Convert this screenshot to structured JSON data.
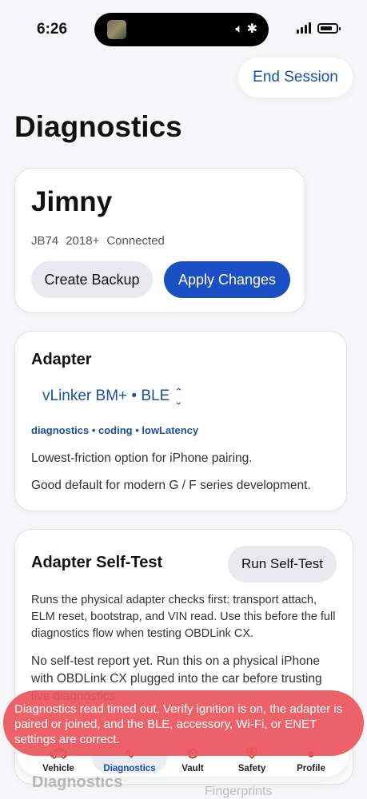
{
  "status_bar": {
    "time": "6:26"
  },
  "header": {
    "end_session": "End Session",
    "title": "Diagnostics"
  },
  "vehicle": {
    "name": "Jimny",
    "meta": [
      "JB74",
      "2018+",
      "Connected"
    ],
    "create_backup": "Create Backup",
    "apply_changes": "Apply Changes"
  },
  "adapter": {
    "heading": "Adapter",
    "selected": "vLinker BM+ • BLE",
    "tags": "diagnostics • coding • lowLatency",
    "line1": "Lowest-friction option for iPhone pairing.",
    "line2": "Good default for modern G / F series development."
  },
  "self_test": {
    "heading": "Adapter Self-Test",
    "run_button": "Run Self-Test",
    "description": "Runs the physical adapter checks first: transport attach, ELM reset, bootstrap, and VIN read. Use this before the full diagnostics flow when testing OBDLink CX.",
    "report": "No self-test report yet. Run this on a physical iPhone with OBDLink CX plugged into the car before trusting live diagnostics."
  },
  "behind": {
    "left": "Diagnostics",
    "right": "Fingerprints"
  },
  "tabs": [
    {
      "label": "Vehicle",
      "icon": "car-icon"
    },
    {
      "label": "Diagnostics",
      "icon": "waveform-icon"
    },
    {
      "label": "Vault",
      "icon": "clock-car-icon"
    },
    {
      "label": "Safety",
      "icon": "shield-icon"
    },
    {
      "label": "Profile",
      "icon": "person-icon"
    }
  ],
  "toast": {
    "message": "Diagnostics read timed out. Verify ignition is on, the adapter is paired or joined, and the BLE, accessory, Wi-Fi, or ENET settings are correct."
  },
  "colors": {
    "accent": "#1d4fa3",
    "primary_button": "#1b4fc4",
    "error": "#ec555c"
  }
}
